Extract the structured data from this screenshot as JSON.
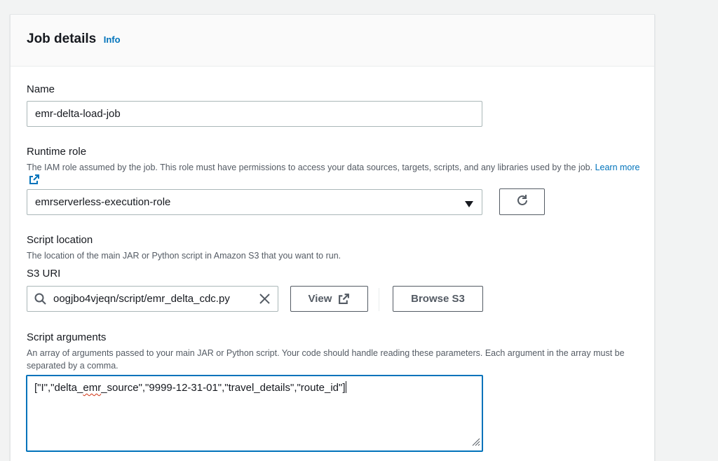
{
  "panel": {
    "title": "Job details",
    "info_label": "Info"
  },
  "name_field": {
    "label": "Name",
    "value": "emr-delta-load-job"
  },
  "runtime_role": {
    "label": "Runtime role",
    "description": "The IAM role assumed by the job. This role must have permissions to access your data sources, targets, scripts, and any libraries used by the job.",
    "learn_more": "Learn more",
    "selected_value": "emrserverless-execution-role"
  },
  "script_location": {
    "label": "Script location",
    "description": "The location of the main JAR or Python script in Amazon S3 that you want to run.",
    "s3_uri_label": "S3 URI",
    "s3_uri_value": "oogjbo4vjeqn/script/emr_delta_cdc.py",
    "view_button": "View",
    "browse_button": "Browse S3"
  },
  "script_arguments": {
    "label": "Script arguments",
    "description": "An array of arguments passed to your main JAR or Python script. Your code should handle reading these parameters. Each argument in the array must be separated by a comma.",
    "value_before": "[\"I\",\"delta_",
    "value_misspelled": "emr",
    "value_after": "_source\",\"9999-12-31-01\",\"travel_details\",\"route_id\"]"
  },
  "icons": [
    "external-link-icon",
    "refresh-icon",
    "caret-down-icon",
    "search-icon",
    "clear-icon",
    "resize-handle-icon"
  ],
  "colors": {
    "link": "#0073bb",
    "focus_border": "#0073bb",
    "text": "#16191f",
    "secondary_text": "#545b64",
    "spellcheck": "#d13212"
  }
}
